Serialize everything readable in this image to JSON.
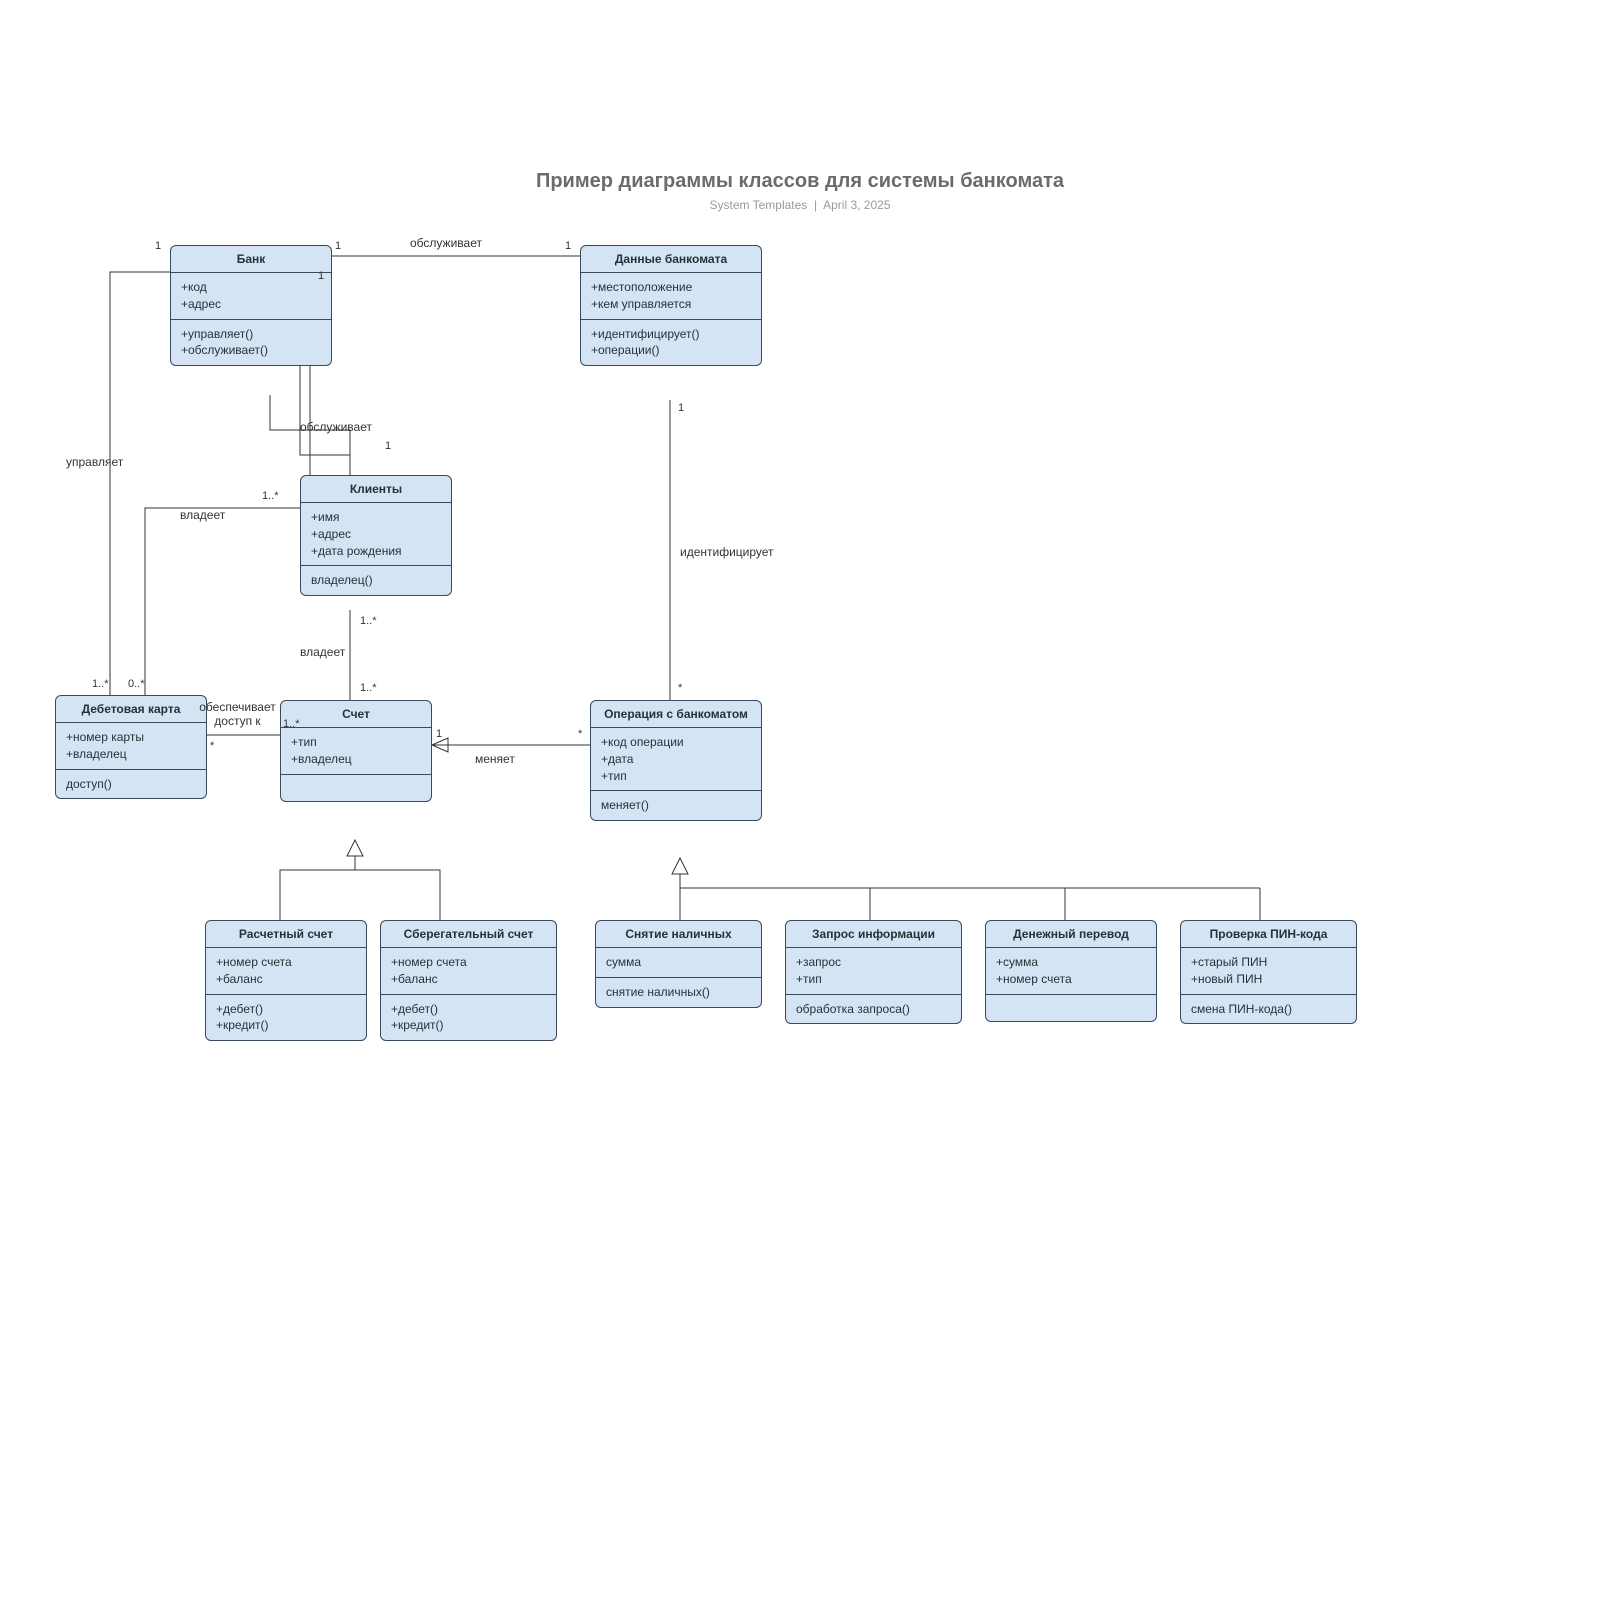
{
  "title": "Пример диаграммы классов для системы банкомата",
  "subtitle_author": "System Templates",
  "subtitle_date": "April 3, 2025",
  "bank": {
    "name": "Банк",
    "attrs": "+код\n+адрес",
    "ops": "+управляет()\n+обслуживает()"
  },
  "atmdata": {
    "name": "Данные банкомата",
    "attrs": "+местоположение\n+кем управляется",
    "ops": "+идентифицирует()\n+операции()"
  },
  "clients": {
    "name": "Клиенты",
    "attrs": "+имя\n+адрес\n+дата рождения",
    "ops": "владелец()"
  },
  "debit": {
    "name": "Дебетовая карта",
    "attrs": "+номер карты\n+владелец",
    "ops": "доступ()"
  },
  "account": {
    "name": "Счет",
    "attrs": "+тип\n+владелец",
    "ops": ""
  },
  "atmop": {
    "name": "Операция с банкоматом",
    "attrs": "+код операции\n+дата\n+тип",
    "ops": "меняет()"
  },
  "checking": {
    "name": "Расчетный счет",
    "attrs": "+номер счета\n+баланс",
    "ops": "+дебет()\n+кредит()"
  },
  "savings": {
    "name": "Сберегательный счет",
    "attrs": "+номер счета\n+баланс",
    "ops": "+дебет()\n+кредит()"
  },
  "withdrawal": {
    "name": "Снятие наличных",
    "attrs": "сумма",
    "ops": "снятие наличных()"
  },
  "query": {
    "name": "Запрос информации",
    "attrs": "+запрос\n+тип",
    "ops": "обработка запроса()"
  },
  "transfer": {
    "name": "Денежный перевод",
    "attrs": "+сумма\n+номер счета",
    "ops": ""
  },
  "pin": {
    "name": "Проверка ПИН-кода",
    "attrs": "+старый ПИН\n+новый ПИН",
    "ops": "смена ПИН-кода()"
  },
  "rel": {
    "serves": "обслуживает",
    "manages": "управляет",
    "owns": "владеет",
    "access": "обеспечивает доступ к",
    "changes": "меняет",
    "identifies": "идентифицирует"
  },
  "mult": {
    "one": "1",
    "one_star": "1..*",
    "zero_star": "0..*",
    "star": "*"
  }
}
